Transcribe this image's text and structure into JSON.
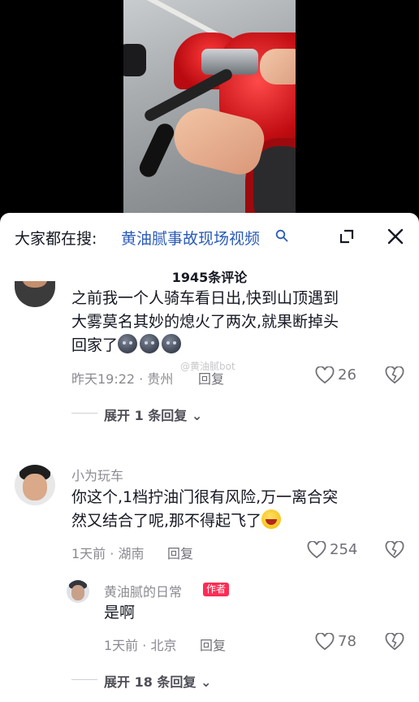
{
  "search": {
    "prefix": "大家都在搜:",
    "query": "黄油腻事故现场视频"
  },
  "comments_header": {
    "count": "1945条评论"
  },
  "comments": [
    {
      "text": "之前我一个人骑车看日出,快到山顶遇到大雾莫名其妙的熄火了两次,就果断掉头回家了",
      "line1": "之前我一个人骑车看日出,快到山顶遇到",
      "line2": "大雾莫名其妙的熄火了两次,就果断掉头",
      "line3": "回家了",
      "meta": "昨天19:22 · 贵州",
      "reply_label": "回复",
      "likes": "26",
      "expand_label": "展开 1 条回复"
    },
    {
      "user": "小为玩车",
      "line1": "你这个,1档拧油门很有风险,万一离合突",
      "line2": "然又结合了呢,那不得起飞了",
      "meta": "1天前 · 湖南",
      "reply_label": "回复",
      "likes": "254",
      "reply": {
        "user": "黄油腻的日常",
        "badge": "作者",
        "text": "是啊",
        "meta": "1天前 · 北京",
        "reply_label": "回复",
        "likes": "78"
      },
      "expand_label": "展开 18 条回复"
    }
  ],
  "watermark": "@黄油腻bot",
  "colors": {
    "link": "#2a5bb8",
    "badge": "#fe2c55",
    "muted": "#8a8b91"
  }
}
